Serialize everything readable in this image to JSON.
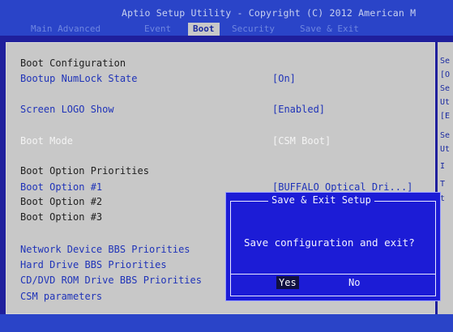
{
  "header": {
    "title": "Aptio Setup Utility - Copyright (C) 2012 American M",
    "tabs": [
      {
        "label": "Main  Advanced",
        "active": false
      },
      {
        "label": "Event",
        "active": false
      },
      {
        "label": "Boot",
        "active": true
      },
      {
        "label": "Security",
        "active": false
      },
      {
        "label": "Save & Exit",
        "active": false
      }
    ]
  },
  "settings": {
    "boot_configuration_heading": "Boot Configuration",
    "bootup_numlock_label": "Bootup NumLock State",
    "bootup_numlock_value": "[On]",
    "screen_logo_label": "Screen LOGO Show",
    "screen_logo_value": "[Enabled]",
    "boot_mode_label": "Boot Mode",
    "boot_mode_value": "[CSM Boot]",
    "boot_priorities_heading": "Boot Option Priorities",
    "boot_option_1_label": "Boot Option #1",
    "boot_option_1_value": "[BUFFALO Optical Dri...]",
    "boot_option_2_label": "Boot Option #2",
    "boot_option_3_label": "Boot Option #3",
    "network_bbs_label": "Network Device BBS Priorities",
    "hard_drive_bbs_label": "Hard Drive BBS Priorities",
    "cddvd_bbs_label": "CD/DVD ROM Drive BBS Priorities",
    "csm_parameters_label": "CSM parameters"
  },
  "help_panel": {
    "lines": [
      "Se",
      "[O",
      "Se",
      "Ut",
      "[E",
      "Se",
      "Ut",
      "I",
      "T",
      "t"
    ]
  },
  "dialog": {
    "title": "Save & Exit Setup",
    "message": "Save configuration and exit?",
    "yes_label": "Yes",
    "no_label": "No"
  },
  "colors": {
    "background_blue": "#1f1f9c",
    "panel_gray": "#c8c8c8",
    "item_blue": "#1f33b8",
    "dialog_blue": "#1c1cd6"
  }
}
